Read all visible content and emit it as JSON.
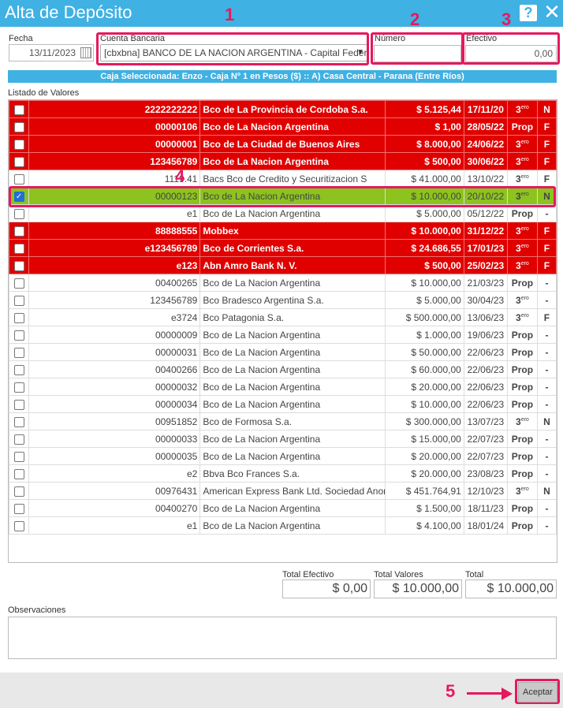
{
  "window": {
    "title": "Alta de Depósito",
    "help_icon": "?",
    "close_icon": "✕"
  },
  "form": {
    "fecha_label": "Fecha",
    "fecha_value": "13/11/2023",
    "cuenta_label": "Cuenta Bancaria",
    "cuenta_value": "[cbxbna] BANCO DE LA NACION ARGENTINA - Capital Feder",
    "numero_label": "Número",
    "numero_value": "",
    "efectivo_label": "Efectivo",
    "efectivo_value": "0,00"
  },
  "caja": "Caja Seleccionada: Enzo - Caja Nº 1 en Pesos ($) :: A) Casa Central - Parana (Entre Ríos)",
  "listado_label": "Listado de Valores",
  "valores": [
    {
      "style": "red",
      "checked": false,
      "numero": "2222222222",
      "banco": "Bco de La Provincia de Cordoba S.a.",
      "importe": "$ 5.125,44",
      "fecha": "17/11/20",
      "tipo": "3",
      "tipo_sup": "ero",
      "flag": "N"
    },
    {
      "style": "red",
      "checked": false,
      "numero": "00000106",
      "banco": "Bco de La Nacion Argentina",
      "importe": "$ 1,00",
      "fecha": "28/05/22",
      "tipo": "Prop",
      "tipo_sup": "",
      "flag": "F"
    },
    {
      "style": "red",
      "checked": false,
      "numero": "00000001",
      "banco": "Bco de La Ciudad de Buenos Aires",
      "importe": "$ 8.000,00",
      "fecha": "24/06/22",
      "tipo": "3",
      "tipo_sup": "ero",
      "flag": "F"
    },
    {
      "style": "red",
      "checked": false,
      "numero": "123456789",
      "banco": "Bco de La Nacion Argentina",
      "importe": "$ 500,00",
      "fecha": "30/06/22",
      "tipo": "3",
      "tipo_sup": "ero",
      "flag": "F"
    },
    {
      "style": "white",
      "checked": false,
      "numero": "1119.41",
      "banco": "Bacs Bco de Credito y Securitizacion S",
      "importe": "$ 41.000,00",
      "fecha": "13/10/22",
      "tipo": "3",
      "tipo_sup": "ero",
      "flag": "F"
    },
    {
      "style": "green",
      "checked": true,
      "numero": "00000123",
      "banco": "Bco de La Nacion Argentina",
      "importe": "$ 10.000,00",
      "fecha": "20/10/22",
      "tipo": "3",
      "tipo_sup": "ero",
      "flag": "N"
    },
    {
      "style": "white",
      "checked": false,
      "numero": "e1",
      "banco": "Bco de La Nacion Argentina",
      "importe": "$ 5.000,00",
      "fecha": "05/12/22",
      "tipo": "Prop",
      "tipo_sup": "",
      "flag": "-"
    },
    {
      "style": "red",
      "checked": false,
      "numero": "88888555",
      "banco": "Mobbex",
      "importe": "$ 10.000,00",
      "fecha": "31/12/22",
      "tipo": "3",
      "tipo_sup": "ero",
      "flag": "F"
    },
    {
      "style": "red",
      "checked": false,
      "numero": "e123456789",
      "banco": "Bco de Corrientes S.a.",
      "importe": "$ 24.686,55",
      "fecha": "17/01/23",
      "tipo": "3",
      "tipo_sup": "ero",
      "flag": "F"
    },
    {
      "style": "red",
      "checked": false,
      "numero": "e123",
      "banco": "Abn Amro Bank N. V.",
      "importe": "$ 500,00",
      "fecha": "25/02/23",
      "tipo": "3",
      "tipo_sup": "ero",
      "flag": "F"
    },
    {
      "style": "white",
      "checked": false,
      "numero": "00400265",
      "banco": "Bco de La Nacion Argentina",
      "importe": "$ 10.000,00",
      "fecha": "21/03/23",
      "tipo": "Prop",
      "tipo_sup": "",
      "flag": "-"
    },
    {
      "style": "white",
      "checked": false,
      "numero": "123456789",
      "banco": "Bco Bradesco Argentina S.a.",
      "importe": "$ 5.000,00",
      "fecha": "30/04/23",
      "tipo": "3",
      "tipo_sup": "ero",
      "flag": "-"
    },
    {
      "style": "white",
      "checked": false,
      "numero": "e3724",
      "banco": "Bco Patagonia S.a.",
      "importe": "$ 500.000,00",
      "fecha": "13/06/23",
      "tipo": "3",
      "tipo_sup": "ero",
      "flag": "F"
    },
    {
      "style": "white",
      "checked": false,
      "numero": "00000009",
      "banco": "Bco de La Nacion Argentina",
      "importe": "$ 1.000,00",
      "fecha": "19/06/23",
      "tipo": "Prop",
      "tipo_sup": "",
      "flag": "-"
    },
    {
      "style": "white",
      "checked": false,
      "numero": "00000031",
      "banco": "Bco de La Nacion Argentina",
      "importe": "$ 50.000,00",
      "fecha": "22/06/23",
      "tipo": "Prop",
      "tipo_sup": "",
      "flag": "-"
    },
    {
      "style": "white",
      "checked": false,
      "numero": "00400266",
      "banco": "Bco de La Nacion Argentina",
      "importe": "$ 60.000,00",
      "fecha": "22/06/23",
      "tipo": "Prop",
      "tipo_sup": "",
      "flag": "-"
    },
    {
      "style": "white",
      "checked": false,
      "numero": "00000032",
      "banco": "Bco de La Nacion Argentina",
      "importe": "$ 20.000,00",
      "fecha": "22/06/23",
      "tipo": "Prop",
      "tipo_sup": "",
      "flag": "-"
    },
    {
      "style": "white",
      "checked": false,
      "numero": "00000034",
      "banco": "Bco de La Nacion Argentina",
      "importe": "$ 10.000,00",
      "fecha": "22/06/23",
      "tipo": "Prop",
      "tipo_sup": "",
      "flag": "-"
    },
    {
      "style": "white",
      "checked": false,
      "numero": "00951852",
      "banco": "Bco de Formosa S.a.",
      "importe": "$ 300.000,00",
      "fecha": "13/07/23",
      "tipo": "3",
      "tipo_sup": "ero",
      "flag": "N"
    },
    {
      "style": "white",
      "checked": false,
      "numero": "00000033",
      "banco": "Bco de La Nacion Argentina",
      "importe": "$ 15.000,00",
      "fecha": "22/07/23",
      "tipo": "Prop",
      "tipo_sup": "",
      "flag": "-"
    },
    {
      "style": "white",
      "checked": false,
      "numero": "00000035",
      "banco": "Bco de La Nacion Argentina",
      "importe": "$ 20.000,00",
      "fecha": "22/07/23",
      "tipo": "Prop",
      "tipo_sup": "",
      "flag": "-"
    },
    {
      "style": "white",
      "checked": false,
      "numero": "e2",
      "banco": "Bbva Bco Frances S.a.",
      "importe": "$ 20.000,00",
      "fecha": "23/08/23",
      "tipo": "Prop",
      "tipo_sup": "",
      "flag": "-"
    },
    {
      "style": "white",
      "checked": false,
      "numero": "00976431",
      "banco": "American Express Bank Ltd. Sociedad Anon",
      "importe": "$ 451.764,91",
      "fecha": "12/10/23",
      "tipo": "3",
      "tipo_sup": "ero",
      "flag": "N"
    },
    {
      "style": "white",
      "checked": false,
      "numero": "00400270",
      "banco": "Bco de La Nacion Argentina",
      "importe": "$ 1.500,00",
      "fecha": "18/11/23",
      "tipo": "Prop",
      "tipo_sup": "",
      "flag": "-"
    },
    {
      "style": "white",
      "checked": false,
      "numero": "e1",
      "banco": "Bco de La Nacion Argentina",
      "importe": "$ 4.100,00",
      "fecha": "18/01/24",
      "tipo": "Prop",
      "tipo_sup": "",
      "flag": "-"
    }
  ],
  "totals": {
    "efectivo_label": "Total Efectivo",
    "efectivo_value": "$ 0,00",
    "valores_label": "Total Valores",
    "valores_value": "$ 10.000,00",
    "total_label": "Total",
    "total_value": "$ 10.000,00"
  },
  "observaciones_label": "Observaciones",
  "observaciones_value": "",
  "aceptar_label": "Aceptar",
  "annotations": {
    "n1": "1",
    "n2": "2",
    "n3": "3",
    "n4": "4",
    "n5": "5"
  },
  "colors": {
    "titlebar": "#3fb1e3",
    "row_red": "#e00000",
    "row_green": "#8cc31e",
    "callout": "#e5195e"
  }
}
